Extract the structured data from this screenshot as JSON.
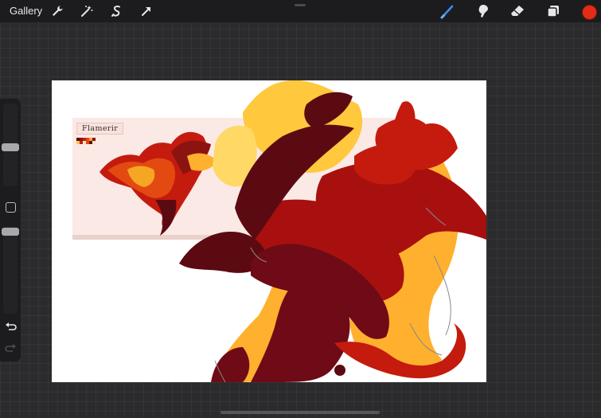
{
  "topbar": {
    "gallery_label": "Gallery",
    "left_tools": [
      "wrench-icon",
      "magic-wand-icon",
      "selection-icon",
      "transform-arrow-icon"
    ],
    "right_tools": [
      "brush-icon",
      "smudge-icon",
      "eraser-icon",
      "layers-icon"
    ],
    "active_tool": "brush-icon",
    "current_color": "#e32b17"
  },
  "sidebar": {
    "brush_size_level": 0.55,
    "opacity_level": 0.5,
    "buttons": [
      "modify-button",
      "undo-arrow-icon",
      "redo-arrow-icon"
    ]
  },
  "canvas": {
    "reference_label": "Flamerir",
    "palette": [
      "#5a0b0e",
      "#8c1410",
      "#c0220f",
      "#e34a12",
      "#f5a623",
      "#f8c84a",
      "#fde7c5"
    ],
    "art_colors": {
      "dark_maroon": "#5c0a12",
      "crimson": "#a8100f",
      "red": "#c41b0e",
      "gold": "#ffc83d",
      "light_gold": "#ffd866",
      "orange": "#ffb02e",
      "reference_bg": "#fbe9e6"
    }
  }
}
